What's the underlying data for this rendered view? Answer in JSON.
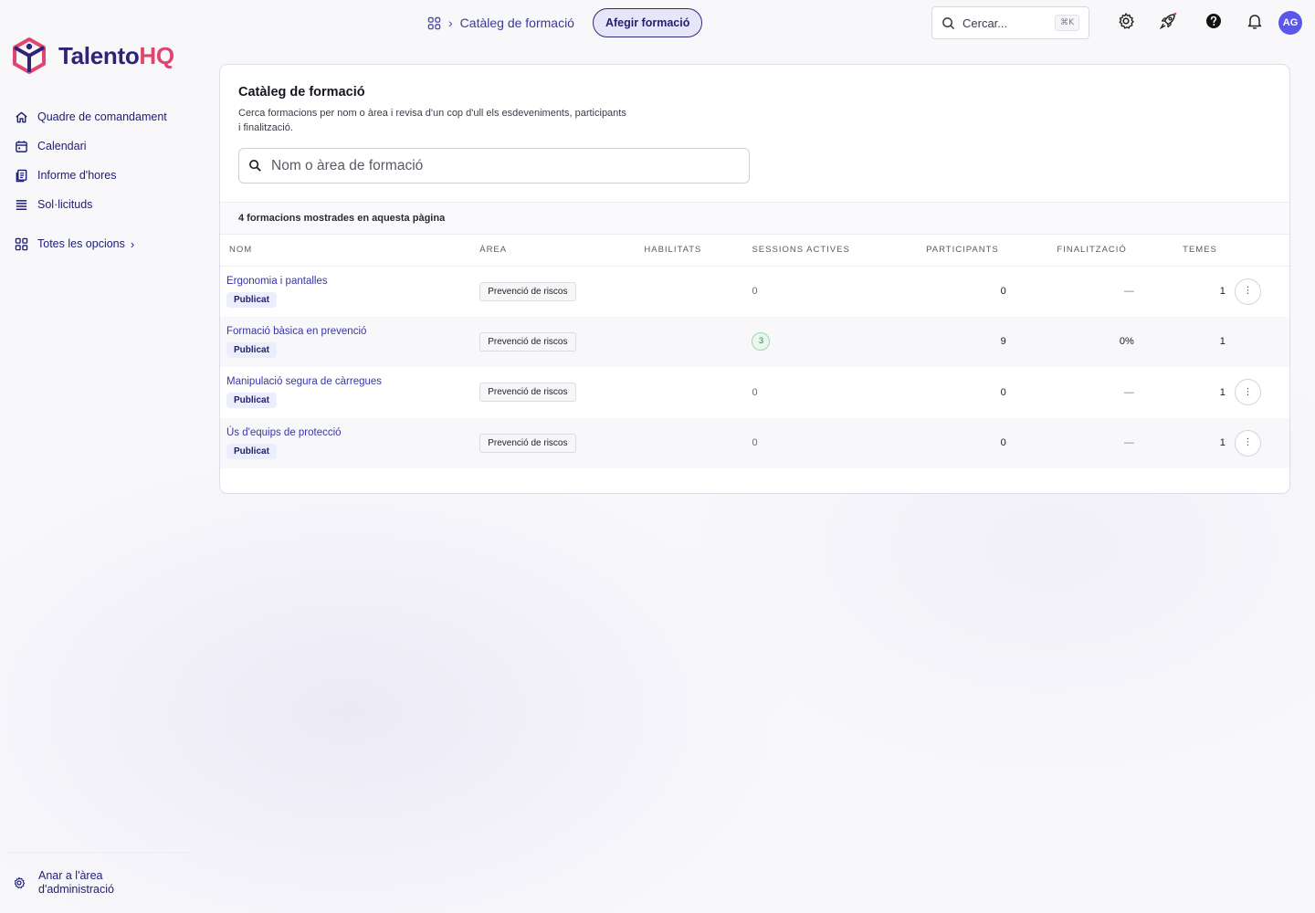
{
  "brand": {
    "name_main": "Talento",
    "name_accent": "HQ"
  },
  "sidebar": {
    "items": [
      {
        "label": "Quadre de comandament",
        "icon": "home-icon"
      },
      {
        "label": "Calendari",
        "icon": "calendar-icon"
      },
      {
        "label": "Informe d'hores",
        "icon": "report-icon"
      },
      {
        "label": "Sol·licituds",
        "icon": "list-icon"
      }
    ],
    "more_label": "Totes les opcions",
    "admin_label": "Anar a l'àrea d'administració"
  },
  "topbar": {
    "breadcrumb": "Catàleg de formació",
    "add_button": "Afegir formació",
    "search_placeholder": "Cercar...",
    "shortcut": "⌘K",
    "avatar": "AG"
  },
  "card": {
    "title": "Catàleg de formació",
    "description": "Cerca formacions per nom o àrea i revisa d'un cop d'ull els esdeveniments, participants i finalització.",
    "search_placeholder": "Nom o àrea de formació",
    "count_text": "4 formacions mostrades en aquesta pàgina"
  },
  "table": {
    "columns": [
      "NOM",
      "ÀREA",
      "HABILITATS",
      "SESSIONS ACTIVES",
      "PARTICIPANTS",
      "FINALITZACIÓ",
      "TEMES"
    ],
    "rows": [
      {
        "name": "Ergonomia i pantalles",
        "status": "Publicat",
        "area": "Prevenció de riscos",
        "sessions": "0",
        "participants": "0",
        "completion": "—",
        "topics": "1",
        "has_menu": true
      },
      {
        "name": "Formació bàsica en prevenció",
        "status": "Publicat",
        "area": "Prevenció de riscos",
        "sessions": "3",
        "participants": "9",
        "completion": "0%",
        "topics": "1",
        "has_menu": false
      },
      {
        "name": "Manipulació segura de càrregues",
        "status": "Publicat",
        "area": "Prevenció de riscos",
        "sessions": "0",
        "participants": "0",
        "completion": "—",
        "topics": "1",
        "has_menu": true
      },
      {
        "name": "Ús d'equips de protecció",
        "status": "Publicat",
        "area": "Prevenció de riscos",
        "sessions": "0",
        "participants": "0",
        "completion": "—",
        "topics": "1",
        "has_menu": true
      }
    ]
  },
  "colors": {
    "brand_navy": "#2d2478",
    "brand_pink": "#e0456f",
    "link": "#3934a8",
    "avatar": "#5b57e8"
  }
}
